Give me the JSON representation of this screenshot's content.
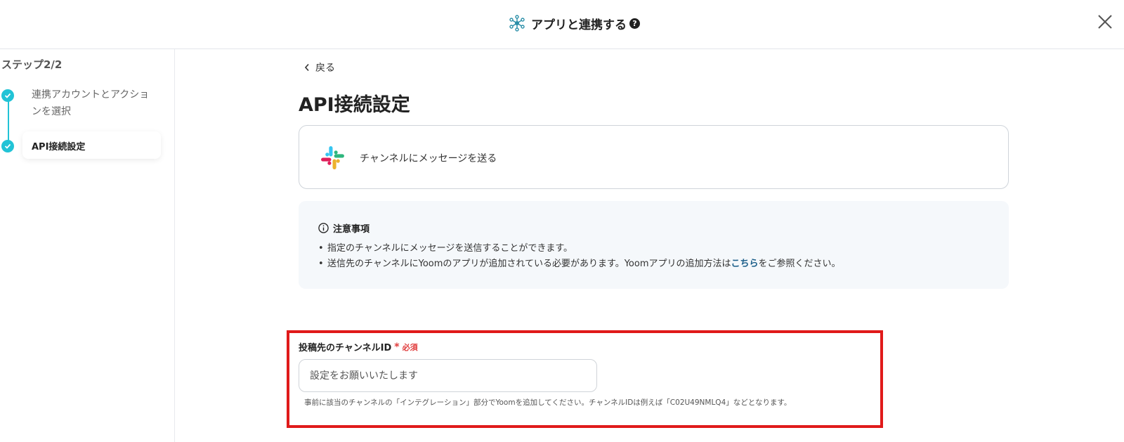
{
  "header": {
    "title": "アプリと連携する",
    "help_icon": "question-circle-icon",
    "close_icon": "close-icon"
  },
  "sidebar": {
    "step_label": "ステップ2/2",
    "steps": [
      {
        "label": "連携アカウントとアクションを選択",
        "status": "done"
      },
      {
        "label": "API接続設定",
        "status": "current"
      }
    ],
    "accent": "#21c3d6"
  },
  "main": {
    "back_label": "戻る",
    "title": "API接続設定",
    "action": {
      "icon": "slack-icon",
      "label": "チャンネルにメッセージを送る"
    },
    "notice": {
      "heading": "注意事項",
      "items": [
        "指定のチャンネルにメッセージを送信することができます。",
        "送信先のチャンネルにYoomのアプリが追加されている必要があります。Yoomアプリの追加方法は"
      ],
      "link_text": "こちら",
      "item2_suffix": "をご参照ください。"
    },
    "field": {
      "label": "投稿先のチャンネルID",
      "required_mark": "*",
      "required_text": "必須",
      "placeholder": "設定をお願いいたします",
      "value": "",
      "help": "事前に該当のチャンネルの「インテグレーション」部分でYoomを追加してください。チャンネルIDは例えば「C02U49NMLQ4」などとなります。"
    },
    "highlight_color": "#e01a1a"
  }
}
